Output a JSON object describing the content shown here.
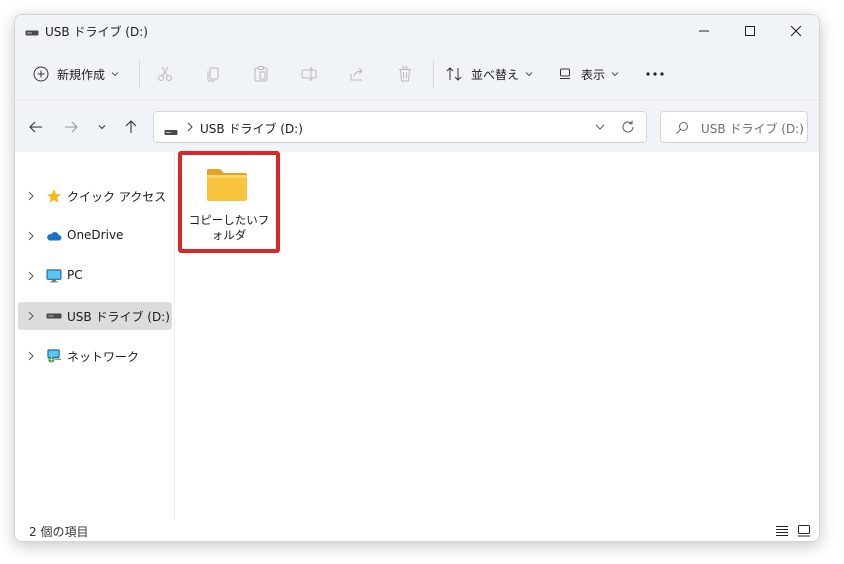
{
  "window": {
    "title": "USB ドライブ (D:)"
  },
  "toolbar": {
    "new_label": "新規作成",
    "sort_label": "並べ替え",
    "view_label": "表示"
  },
  "address": {
    "path": "USB ドライブ (D:)",
    "search_placeholder": "USB ドライブ (D:)の..."
  },
  "sidebar": {
    "items": [
      {
        "label": "クイック アクセス",
        "icon": "star-icon"
      },
      {
        "label": "OneDrive",
        "icon": "cloud-icon"
      },
      {
        "label": "PC",
        "icon": "monitor-icon"
      },
      {
        "label": "USB ドライブ (D:)",
        "icon": "drive-icon",
        "selected": true
      },
      {
        "label": "ネットワーク",
        "icon": "network-icon"
      }
    ]
  },
  "content": {
    "items": [
      {
        "name": "コピーしたいフォルダ",
        "type": "folder",
        "highlighted": true
      }
    ]
  },
  "status": {
    "item_count": "2 個の項目"
  },
  "colors": {
    "chrome_bg": "#f0f4f9",
    "highlight_border": "#d9282b",
    "folder_yellow": "#f8c33d",
    "selected_bg": "#dcdcdc"
  }
}
